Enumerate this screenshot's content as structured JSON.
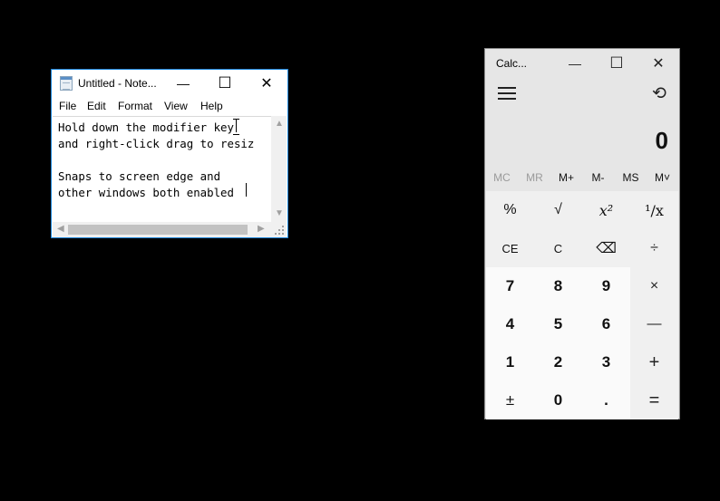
{
  "notepad": {
    "title": "Untitled - Note...",
    "menu": [
      "File",
      "Edit",
      "Format",
      "View",
      "Help"
    ],
    "lines": [
      "Hold down the modifier key",
      "and right-click drag to resiz",
      "",
      "Snaps to screen edge and",
      "other windows both enabled"
    ],
    "controls": {
      "minimize": "—",
      "maximize": "☐",
      "close": "✕"
    }
  },
  "calculator": {
    "title": "Calc...",
    "controls": {
      "minimize": "—",
      "maximize": "☐",
      "close": "✕"
    },
    "history_glyph": "⟲",
    "display": "0",
    "memory": [
      {
        "label": "MC",
        "enabled": false
      },
      {
        "label": "MR",
        "enabled": false
      },
      {
        "label": "M+",
        "enabled": true
      },
      {
        "label": "M-",
        "enabled": true
      },
      {
        "label": "MS",
        "enabled": true
      },
      {
        "label": "M˅",
        "enabled": true
      }
    ],
    "keys": [
      [
        "%",
        "√",
        "x²",
        "¹/x"
      ],
      [
        "CE",
        "C",
        "⌫",
        "÷"
      ],
      [
        "7",
        "8",
        "9",
        "×"
      ],
      [
        "4",
        "5",
        "6",
        "—"
      ],
      [
        "1",
        "2",
        "3",
        "+"
      ],
      [
        "±",
        "0",
        ".",
        "="
      ]
    ]
  }
}
